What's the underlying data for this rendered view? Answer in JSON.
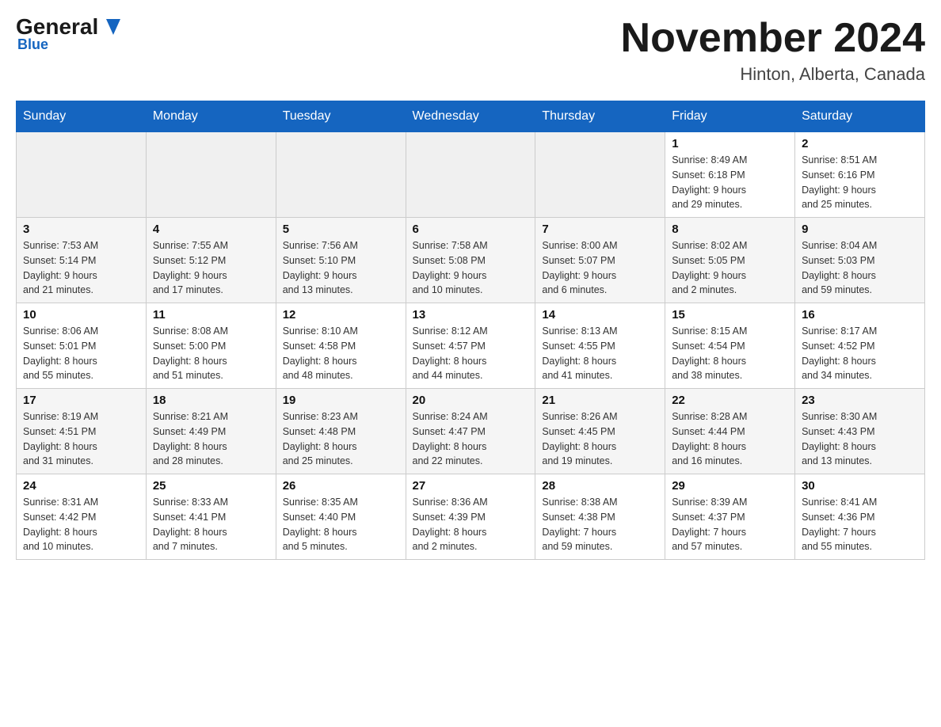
{
  "header": {
    "logo_general": "General",
    "logo_blue": "Blue",
    "month_title": "November 2024",
    "location": "Hinton, Alberta, Canada"
  },
  "days_of_week": [
    "Sunday",
    "Monday",
    "Tuesday",
    "Wednesday",
    "Thursday",
    "Friday",
    "Saturday"
  ],
  "weeks": [
    {
      "days": [
        {
          "number": "",
          "info": ""
        },
        {
          "number": "",
          "info": ""
        },
        {
          "number": "",
          "info": ""
        },
        {
          "number": "",
          "info": ""
        },
        {
          "number": "",
          "info": ""
        },
        {
          "number": "1",
          "info": "Sunrise: 8:49 AM\nSunset: 6:18 PM\nDaylight: 9 hours\nand 29 minutes."
        },
        {
          "number": "2",
          "info": "Sunrise: 8:51 AM\nSunset: 6:16 PM\nDaylight: 9 hours\nand 25 minutes."
        }
      ]
    },
    {
      "days": [
        {
          "number": "3",
          "info": "Sunrise: 7:53 AM\nSunset: 5:14 PM\nDaylight: 9 hours\nand 21 minutes."
        },
        {
          "number": "4",
          "info": "Sunrise: 7:55 AM\nSunset: 5:12 PM\nDaylight: 9 hours\nand 17 minutes."
        },
        {
          "number": "5",
          "info": "Sunrise: 7:56 AM\nSunset: 5:10 PM\nDaylight: 9 hours\nand 13 minutes."
        },
        {
          "number": "6",
          "info": "Sunrise: 7:58 AM\nSunset: 5:08 PM\nDaylight: 9 hours\nand 10 minutes."
        },
        {
          "number": "7",
          "info": "Sunrise: 8:00 AM\nSunset: 5:07 PM\nDaylight: 9 hours\nand 6 minutes."
        },
        {
          "number": "8",
          "info": "Sunrise: 8:02 AM\nSunset: 5:05 PM\nDaylight: 9 hours\nand 2 minutes."
        },
        {
          "number": "9",
          "info": "Sunrise: 8:04 AM\nSunset: 5:03 PM\nDaylight: 8 hours\nand 59 minutes."
        }
      ]
    },
    {
      "days": [
        {
          "number": "10",
          "info": "Sunrise: 8:06 AM\nSunset: 5:01 PM\nDaylight: 8 hours\nand 55 minutes."
        },
        {
          "number": "11",
          "info": "Sunrise: 8:08 AM\nSunset: 5:00 PM\nDaylight: 8 hours\nand 51 minutes."
        },
        {
          "number": "12",
          "info": "Sunrise: 8:10 AM\nSunset: 4:58 PM\nDaylight: 8 hours\nand 48 minutes."
        },
        {
          "number": "13",
          "info": "Sunrise: 8:12 AM\nSunset: 4:57 PM\nDaylight: 8 hours\nand 44 minutes."
        },
        {
          "number": "14",
          "info": "Sunrise: 8:13 AM\nSunset: 4:55 PM\nDaylight: 8 hours\nand 41 minutes."
        },
        {
          "number": "15",
          "info": "Sunrise: 8:15 AM\nSunset: 4:54 PM\nDaylight: 8 hours\nand 38 minutes."
        },
        {
          "number": "16",
          "info": "Sunrise: 8:17 AM\nSunset: 4:52 PM\nDaylight: 8 hours\nand 34 minutes."
        }
      ]
    },
    {
      "days": [
        {
          "number": "17",
          "info": "Sunrise: 8:19 AM\nSunset: 4:51 PM\nDaylight: 8 hours\nand 31 minutes."
        },
        {
          "number": "18",
          "info": "Sunrise: 8:21 AM\nSunset: 4:49 PM\nDaylight: 8 hours\nand 28 minutes."
        },
        {
          "number": "19",
          "info": "Sunrise: 8:23 AM\nSunset: 4:48 PM\nDaylight: 8 hours\nand 25 minutes."
        },
        {
          "number": "20",
          "info": "Sunrise: 8:24 AM\nSunset: 4:47 PM\nDaylight: 8 hours\nand 22 minutes."
        },
        {
          "number": "21",
          "info": "Sunrise: 8:26 AM\nSunset: 4:45 PM\nDaylight: 8 hours\nand 19 minutes."
        },
        {
          "number": "22",
          "info": "Sunrise: 8:28 AM\nSunset: 4:44 PM\nDaylight: 8 hours\nand 16 minutes."
        },
        {
          "number": "23",
          "info": "Sunrise: 8:30 AM\nSunset: 4:43 PM\nDaylight: 8 hours\nand 13 minutes."
        }
      ]
    },
    {
      "days": [
        {
          "number": "24",
          "info": "Sunrise: 8:31 AM\nSunset: 4:42 PM\nDaylight: 8 hours\nand 10 minutes."
        },
        {
          "number": "25",
          "info": "Sunrise: 8:33 AM\nSunset: 4:41 PM\nDaylight: 8 hours\nand 7 minutes."
        },
        {
          "number": "26",
          "info": "Sunrise: 8:35 AM\nSunset: 4:40 PM\nDaylight: 8 hours\nand 5 minutes."
        },
        {
          "number": "27",
          "info": "Sunrise: 8:36 AM\nSunset: 4:39 PM\nDaylight: 8 hours\nand 2 minutes."
        },
        {
          "number": "28",
          "info": "Sunrise: 8:38 AM\nSunset: 4:38 PM\nDaylight: 7 hours\nand 59 minutes."
        },
        {
          "number": "29",
          "info": "Sunrise: 8:39 AM\nSunset: 4:37 PM\nDaylight: 7 hours\nand 57 minutes."
        },
        {
          "number": "30",
          "info": "Sunrise: 8:41 AM\nSunset: 4:36 PM\nDaylight: 7 hours\nand 55 minutes."
        }
      ]
    }
  ]
}
